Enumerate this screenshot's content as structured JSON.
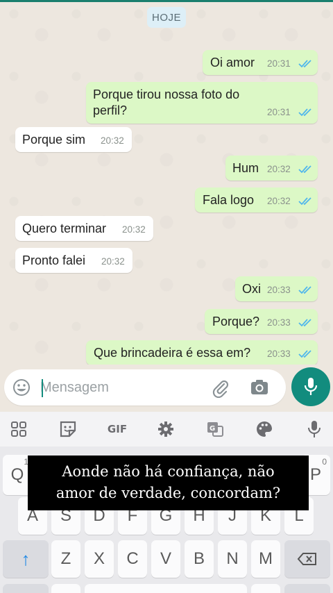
{
  "date_label": "HOJE",
  "messages": [
    {
      "dir": "out",
      "text": "Oi amor",
      "time": "20:31"
    },
    {
      "dir": "out",
      "text": "Porque tirou nossa foto do perfil?",
      "text_line1": "Porque tirou nossa foto do",
      "text_line2": "perfil?",
      "time": "20:31"
    },
    {
      "dir": "in",
      "text": "Porque sim",
      "time": "20:32"
    },
    {
      "dir": "out",
      "text": "Hum",
      "time": "20:32"
    },
    {
      "dir": "out",
      "text": "Fala logo",
      "time": "20:32"
    },
    {
      "dir": "in",
      "text": "Quero terminar",
      "time": "20:32"
    },
    {
      "dir": "in",
      "text": "Pronto falei",
      "time": "20:32"
    },
    {
      "dir": "out",
      "text": "Oxi",
      "time": "20:33"
    },
    {
      "dir": "out",
      "text": "Porque?",
      "time": "20:33"
    },
    {
      "dir": "out",
      "text": "Que brincadeira é essa em?",
      "time": "20:33"
    }
  ],
  "composer": {
    "placeholder": "Mensagem",
    "icons": [
      "emoji-icon",
      "attach-icon",
      "camera-icon",
      "mic-icon"
    ]
  },
  "keyboard_toolbar": {
    "icons": [
      "apps-grid-icon",
      "sticker-icon",
      "gif-icon",
      "settings-gear-icon",
      "translate-icon",
      "palette-icon",
      "voice-mic-icon"
    ],
    "gif_label": "GIF"
  },
  "keyboard": {
    "row1_visible": [
      {
        "label": "Q",
        "sup": "1"
      },
      {
        "label": "P",
        "sup": "0"
      }
    ],
    "row2": [
      "A",
      "S",
      "D",
      "F",
      "G",
      "H",
      "J",
      "K",
      "L"
    ],
    "row3": [
      "Z",
      "X",
      "C",
      "V",
      "B",
      "N",
      "M"
    ],
    "shift_symbol": "↑",
    "backspace_icon": "backspace-icon"
  },
  "caption": {
    "line1": "Aonde não há confiança, não",
    "line2": "amor de verdade, concordam?"
  },
  "colors": {
    "outgoing_bubble": "#DCF8C6",
    "incoming_bubble": "#FFFFFF",
    "read_ticks": "#4FB6EC",
    "accent": "#128C7E"
  }
}
